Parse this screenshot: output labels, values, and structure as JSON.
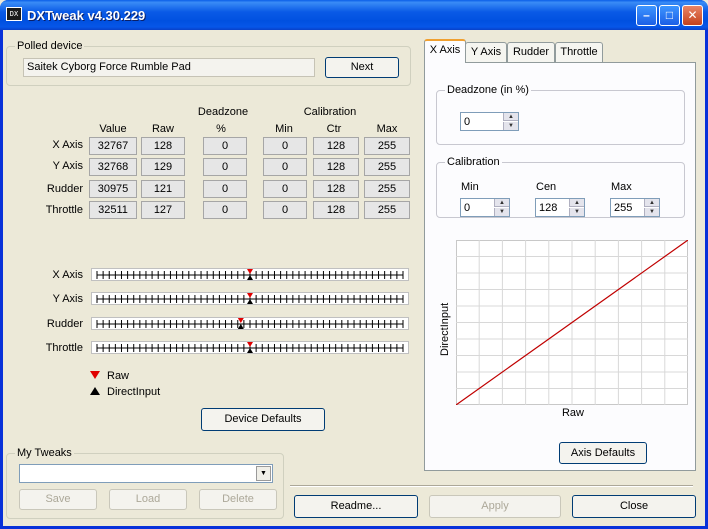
{
  "window": {
    "title": "DXTweak v4.30.229",
    "icon_text": "DX"
  },
  "polled_device": {
    "group_label": "Polled device",
    "device_name": "Saitek Cyborg Force Rumble Pad",
    "next_label": "Next"
  },
  "table": {
    "header_top": {
      "deadzone": "Deadzone",
      "calibration": "Calibration"
    },
    "columns": [
      "Value",
      "Raw",
      "%",
      "Min",
      "Ctr",
      "Max"
    ],
    "rows": [
      {
        "label": "X Axis",
        "value": "32767",
        "raw": "128",
        "dz": "0",
        "min": "0",
        "ctr": "128",
        "max": "255"
      },
      {
        "label": "Y Axis",
        "value": "32768",
        "raw": "129",
        "dz": "0",
        "min": "0",
        "ctr": "128",
        "max": "255"
      },
      {
        "label": "Rudder",
        "value": "30975",
        "raw": "121",
        "dz": "0",
        "min": "0",
        "ctr": "128",
        "max": "255"
      },
      {
        "label": "Throttle",
        "value": "32511",
        "raw": "127",
        "dz": "0",
        "min": "0",
        "ctr": "128",
        "max": "255"
      }
    ]
  },
  "sliders": [
    {
      "label": "X Axis",
      "raw_fraction": 0.5,
      "di_fraction": 0.5
    },
    {
      "label": "Y Axis",
      "raw_fraction": 0.5,
      "di_fraction": 0.5
    },
    {
      "label": "Rudder",
      "raw_fraction": 0.47,
      "di_fraction": 0.47
    },
    {
      "label": "Throttle",
      "raw_fraction": 0.5,
      "di_fraction": 0.5
    }
  ],
  "legend": {
    "raw": "Raw",
    "direct_input": "DirectInput",
    "raw_color": "#e00000",
    "di_color": "#000000"
  },
  "device_defaults_label": "Device Defaults",
  "my_tweaks": {
    "group_label": "My Tweaks",
    "combo_value": "",
    "save_label": "Save",
    "load_label": "Load",
    "delete_label": "Delete"
  },
  "tabs": [
    "X Axis",
    "Y Axis",
    "Rudder",
    "Throttle"
  ],
  "active_tab": "X Axis",
  "axis_panel": {
    "deadzone_label": "Deadzone (in %)",
    "deadzone_value": "0",
    "calibration_label": "Calibration",
    "min_label": "Min",
    "cen_label": "Cen",
    "max_label": "Max",
    "min_value": "0",
    "cen_value": "128",
    "max_value": "255",
    "chart_xlabel": "Raw",
    "chart_ylabel": "DirectInput",
    "axis_defaults_label": "Axis Defaults"
  },
  "chart_data": {
    "type": "line",
    "title": "",
    "xlabel": "Raw",
    "ylabel": "DirectInput",
    "xlim": [
      0,
      255
    ],
    "ylim": [
      0,
      255
    ],
    "grid": true,
    "series": [
      {
        "x": [
          0,
          255
        ],
        "values": [
          0,
          255
        ],
        "color": "#c00000"
      }
    ]
  },
  "bottom_buttons": {
    "readme": "Readme...",
    "apply": "Apply",
    "close": "Close"
  }
}
